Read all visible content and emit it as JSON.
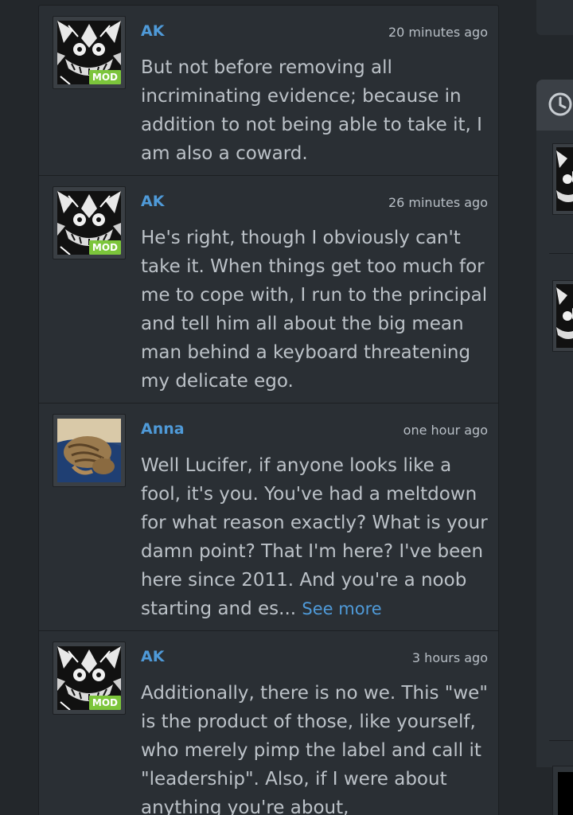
{
  "comments": [
    {
      "author": "AK",
      "time": "20 minutes ago",
      "badge": "MOD",
      "text": "But not before removing all incriminating evidence; because in addition to not being able to take it, I am also a coward."
    },
    {
      "author": "AK",
      "time": "26 minutes ago",
      "badge": "MOD",
      "text": "He's right, though I obviously can't take it. When things get too much for me to cope with, I run to the principal and tell him all about the big mean man behind a keyboard threatening my delicate ego."
    },
    {
      "author": "Anna",
      "time": "one hour ago",
      "text": "Well Lucifer, if anyone looks like a fool, it's you. You've had a meltdown for what reason exactly? What is your damn point? That I'm here? I've been here since 2011. And you're a noob starting and es...",
      "see_more": "See more"
    },
    {
      "author": "AK",
      "time": "3 hours ago",
      "badge": "MOD",
      "text": "Additionally, there is no we. This \"we\" is the product of those, like yourself, who merely pimp the label and call it \"leadership\". Also, if I were about anything you're about,"
    }
  ],
  "icons": {
    "sidebar_header": "clock-icon",
    "avatar_ak": "skull-pattern-avatar",
    "avatar_anna": "cat-photo-avatar"
  },
  "colors": {
    "background": "#23272b",
    "card": "#2a2f34",
    "author_link": "#4f9ad8",
    "mod_badge": "#7cc53b",
    "body_text": "#bcc2c8"
  }
}
